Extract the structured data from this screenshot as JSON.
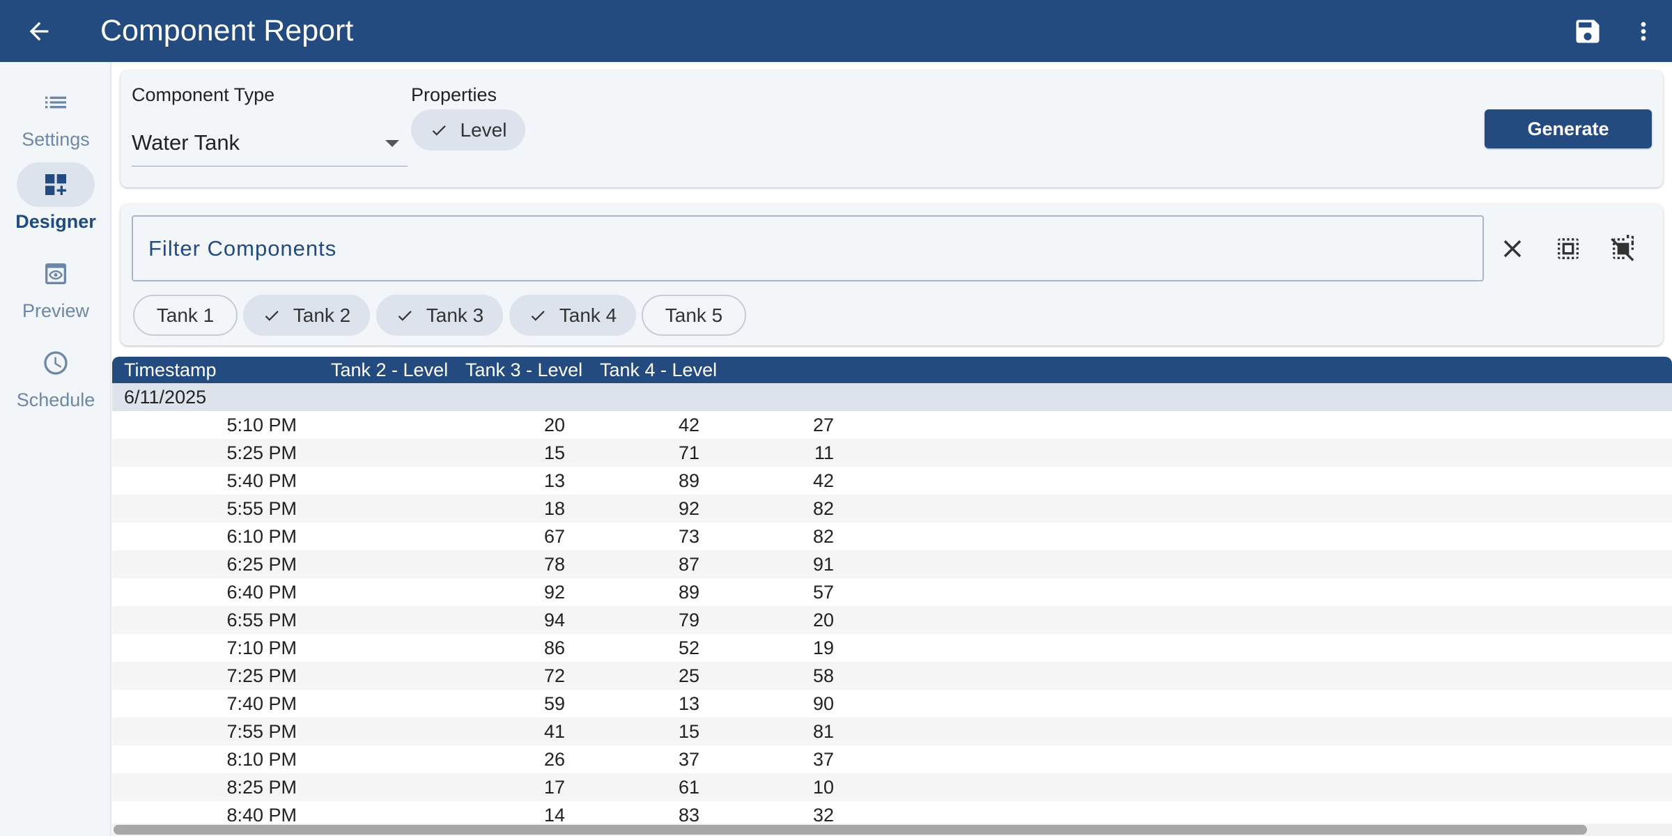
{
  "appbar": {
    "title": "Component Report",
    "icons": [
      "arrow-back-icon",
      "save-icon",
      "more-vert-icon"
    ]
  },
  "rail": {
    "items": [
      {
        "label": "Settings",
        "icon": "list-icon",
        "active": false
      },
      {
        "label": "Designer",
        "icon": "dashboard-add-icon",
        "active": true
      },
      {
        "label": "Preview",
        "icon": "preview-eye-icon",
        "active": false
      },
      {
        "label": "Schedule",
        "icon": "clock-icon",
        "active": false
      }
    ]
  },
  "config": {
    "component_type_label": "Component Type",
    "component_type_value": "Water Tank",
    "properties_label": "Properties",
    "properties": [
      {
        "label": "Level",
        "selected": true
      }
    ],
    "generate_label": "Generate"
  },
  "filter": {
    "placeholder": "Filter Components",
    "icons": [
      "clear-icon",
      "select-all-icon",
      "deselect-all-icon"
    ],
    "chips": [
      {
        "label": "Tank 1",
        "selected": false
      },
      {
        "label": "Tank 2",
        "selected": true
      },
      {
        "label": "Tank 3",
        "selected": true
      },
      {
        "label": "Tank 4",
        "selected": true
      },
      {
        "label": "Tank 5",
        "selected": false
      }
    ]
  },
  "table": {
    "headers": [
      "Timestamp",
      "Tank 2 - Level",
      "Tank 3 - Level",
      "Tank 4 - Level"
    ],
    "group": "6/11/2025",
    "rows": [
      [
        "5:10 PM",
        "20",
        "42",
        "27"
      ],
      [
        "5:25 PM",
        "15",
        "71",
        "11"
      ],
      [
        "5:40 PM",
        "13",
        "89",
        "42"
      ],
      [
        "5:55 PM",
        "18",
        "92",
        "82"
      ],
      [
        "6:10 PM",
        "67",
        "73",
        "82"
      ],
      [
        "6:25 PM",
        "78",
        "87",
        "91"
      ],
      [
        "6:40 PM",
        "92",
        "89",
        "57"
      ],
      [
        "6:55 PM",
        "94",
        "79",
        "20"
      ],
      [
        "7:10 PM",
        "86",
        "52",
        "19"
      ],
      [
        "7:25 PM",
        "72",
        "25",
        "58"
      ],
      [
        "7:40 PM",
        "59",
        "13",
        "90"
      ],
      [
        "7:55 PM",
        "41",
        "15",
        "81"
      ],
      [
        "8:10 PM",
        "26",
        "37",
        "37"
      ],
      [
        "8:25 PM",
        "17",
        "61",
        "10"
      ],
      [
        "8:40 PM",
        "14",
        "83",
        "32"
      ]
    ]
  },
  "colors": {
    "primary": "#234b80",
    "surface": "#f3f6f9",
    "chip_selected": "#dde3ec"
  }
}
